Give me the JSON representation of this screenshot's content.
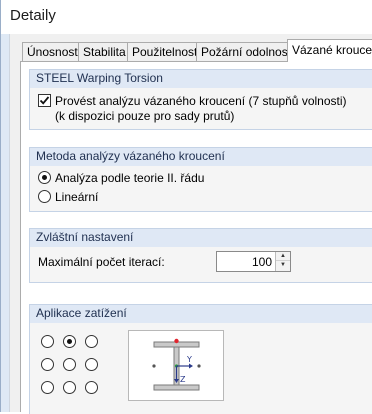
{
  "window": {
    "title": "Detaily"
  },
  "tabs": [
    {
      "label": "Únosnost"
    },
    {
      "label": "Stabilita"
    },
    {
      "label": "Použitelnost"
    },
    {
      "label": "Požární odolnost"
    },
    {
      "label": "Vázané kroucení",
      "active": true
    }
  ],
  "warping_group": {
    "header": "STEEL Warping Torsion",
    "checkbox_label_line1": "Provést analýzu vázaného kroucení (7 stupňů volnosti)",
    "checkbox_label_line2": "(k dispozici pouze pro sady prutů)",
    "checked": true
  },
  "method_group": {
    "header": "Metoda analýzy vázaného kroucení",
    "options": [
      {
        "label": "Analýza podle teorie II. řádu",
        "selected": true
      },
      {
        "label": "Lineární",
        "selected": false
      }
    ]
  },
  "special_group": {
    "header": "Zvláštní nastavení",
    "max_iterations_label": "Maximální počet iterací:",
    "max_iterations_value": "100"
  },
  "load_group": {
    "header": "Aplikace zatížení",
    "grid_selected": "row1-col2",
    "axis_y": "Y",
    "axis_z": "Z"
  },
  "colors": {
    "header_bg": "#dfe8f5",
    "window_bg": "#dfe9f5",
    "load_point": "#e0242e",
    "centroid": "#2e9e3e",
    "axis": "#2a3a8a"
  }
}
